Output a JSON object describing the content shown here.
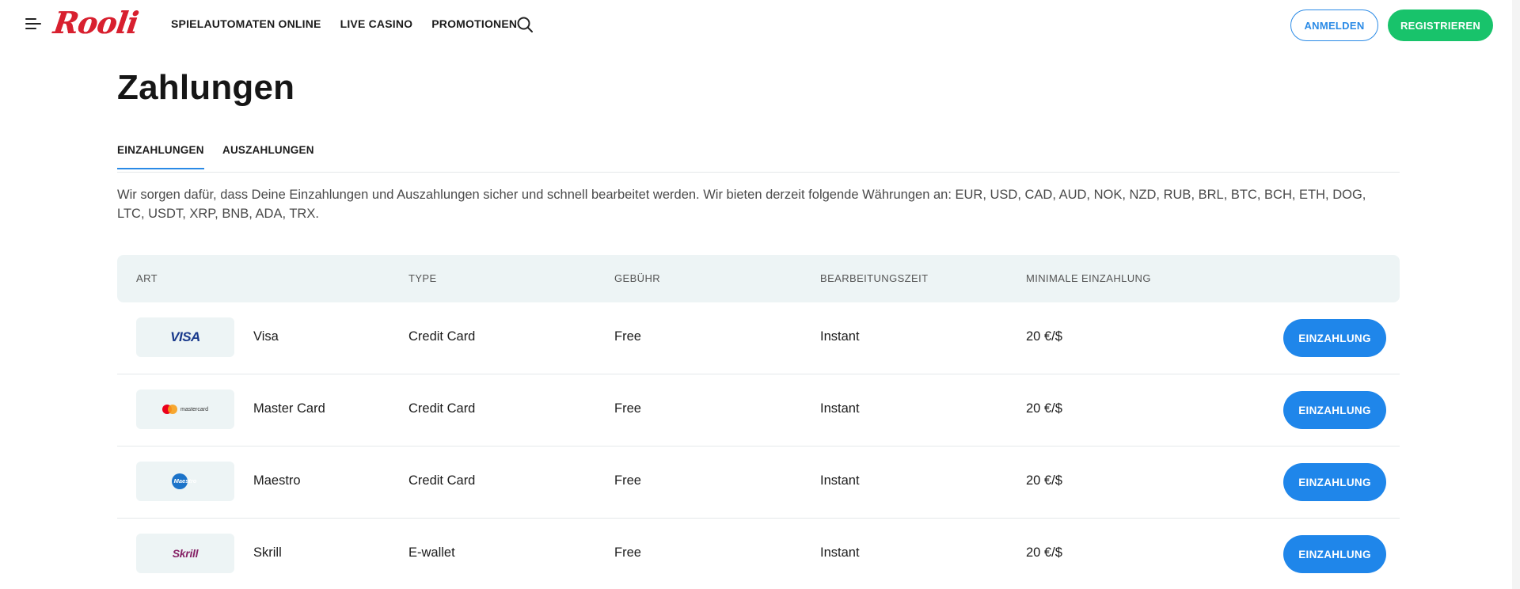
{
  "header": {
    "logo_text": "Rooli",
    "nav": [
      "SPIELAUTOMATEN ONLINE",
      "LIVE CASINO",
      "PROMOTIONEN"
    ],
    "login_label": "ANMELDEN",
    "register_label": "REGISTRIEREN",
    "icons": {
      "menu": "hamburger-icon",
      "search": "search-icon"
    },
    "colors": {
      "brand": "#d8202f",
      "login": "#2a8ae6",
      "register": "#18c36b"
    }
  },
  "page": {
    "title": "Zahlungen",
    "tabs": [
      {
        "label": "EINZAHLUNGEN",
        "active": true
      },
      {
        "label": "AUSZAHLUNGEN",
        "active": false
      }
    ],
    "intro": "Wir sorgen dafür, dass Deine Einzahlungen und Auszahlungen sicher und schnell bearbeitet werden. Wir bieten derzeit folgende Währungen an: EUR, USD, CAD, AUD, NOK, NZD, RUB, BRL, BTC, BCH, ETH, DOG, LTC, USDT, XRP, BNB, ADA, TRX."
  },
  "table": {
    "columns": [
      "ART",
      "TYPE",
      "GEBÜHR",
      "BEARBEITUNGSZEIT",
      "MINIMALE EINZAHLUNG"
    ],
    "rows": [
      {
        "logo": "VISA",
        "name": "Visa",
        "type": "Credit Card",
        "fee": "Free",
        "time": "Instant",
        "min": "20 €/$",
        "action": "EINZAHLUNG"
      },
      {
        "logo": "mastercard",
        "name": "Master Card",
        "type": "Credit Card",
        "fee": "Free",
        "time": "Instant",
        "min": "20 €/$",
        "action": "EINZAHLUNG"
      },
      {
        "logo": "Maestro",
        "name": "Maestro",
        "type": "Credit Card",
        "fee": "Free",
        "time": "Instant",
        "min": "20 €/$",
        "action": "EINZAHLUNG"
      },
      {
        "logo": "Skrill",
        "name": "Skrill",
        "type": "E-wallet",
        "fee": "Free",
        "time": "Instant",
        "min": "20 €/$",
        "action": "EINZAHLUNG"
      }
    ],
    "button_color": "#1f86ea"
  }
}
